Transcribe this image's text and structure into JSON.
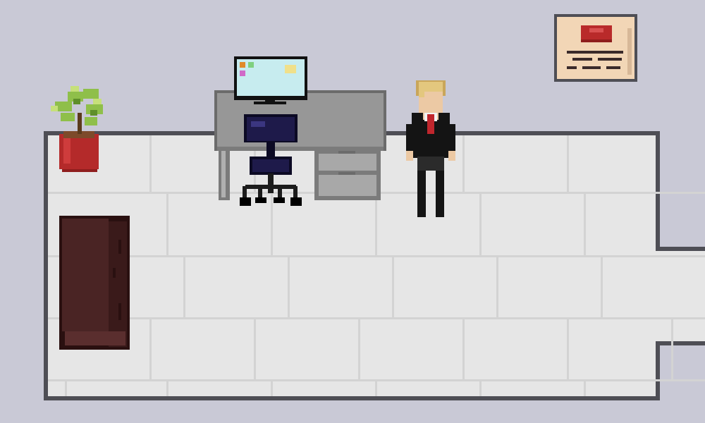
{
  "scene": {
    "type": "pixel-art-office-room",
    "palette": {
      "wall": "#c9c9d6",
      "floor": "#e6e6e6",
      "floor_grout": "#d3d3d3",
      "floor_border": "#4e4e55",
      "desk": "#979797",
      "desk_dark": "#7b7b7b",
      "chair": "#1e1a4a",
      "monitor_screen": "#c7ecef",
      "plant_pot": "#b42a2a",
      "plant_leaves": "#8fbf4a",
      "cabinet": "#4a2424",
      "suit": "#141414",
      "tie": "#c0262d",
      "hair": "#e3c77e",
      "skin": "#ecc9a4",
      "poster_paper": "#f2d6b6",
      "poster_seal": "#b92a2a"
    },
    "objects": {
      "plant": "potted-plant",
      "desk": "office-desk",
      "monitor": "computer-monitor",
      "chair": "office-chair",
      "cabinet": "wooden-cabinet",
      "character": "businessman-character",
      "poster": "wall-certificate"
    }
  }
}
